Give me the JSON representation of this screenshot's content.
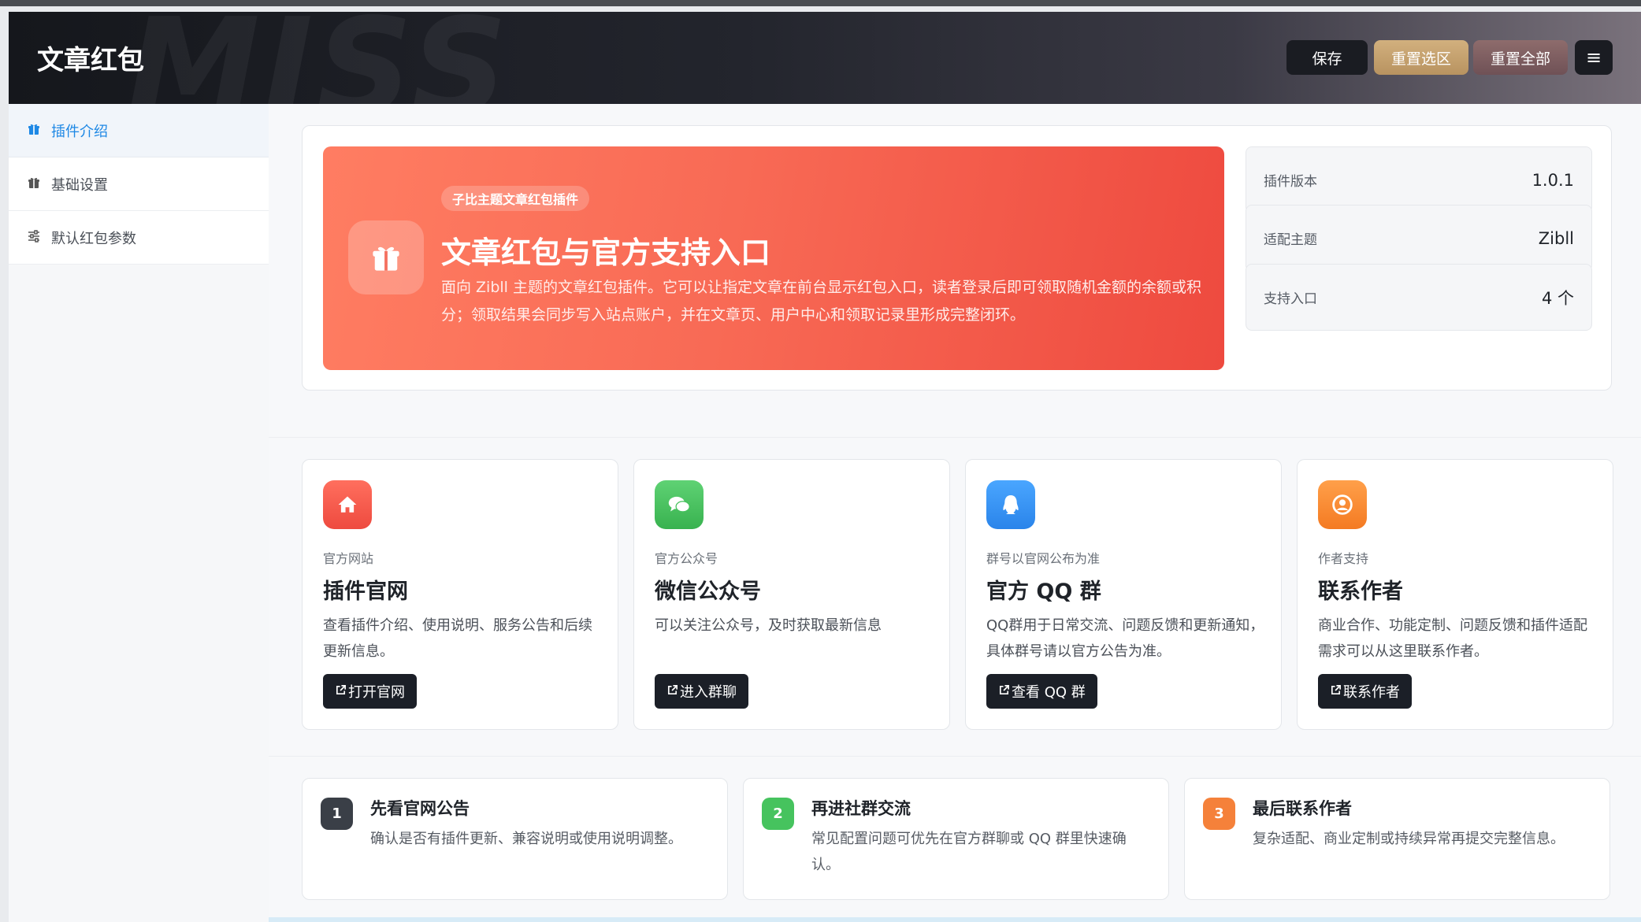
{
  "app": {
    "title": "文章红包",
    "watermark": "MISS"
  },
  "toolbar": {
    "save_label": "保存",
    "reset_selection_label": "重置选区",
    "reset_all_label": "重置全部",
    "menu_glyph": "≡"
  },
  "sidebar": {
    "items": [
      {
        "label": "插件介绍",
        "icon": "gift-icon",
        "active": true
      },
      {
        "label": "基础设置",
        "icon": "gift-icon",
        "active": false
      },
      {
        "label": "默认红包参数",
        "icon": "sliders-icon",
        "active": false
      }
    ]
  },
  "hero": {
    "badge": "子比主题文章红包插件",
    "title": "文章红包与官方支持入口",
    "description": "面向 Zibll 主题的文章红包插件。它可以让指定文章在前台显示红包入口，读者登录后即可领取随机金额的余额或积分；领取结果会同步写入站点账户，并在文章页、用户中心和领取记录里形成完整闭环。"
  },
  "stats": [
    {
      "label": "插件版本",
      "value": "1.0.1"
    },
    {
      "label": "适配主题",
      "value": "Zibll"
    },
    {
      "label": "支持入口",
      "value": "4 个"
    }
  ],
  "links": [
    {
      "icon": "home-icon",
      "color": "#f05a4a",
      "subtitle": "官方网站",
      "title": "插件官网",
      "description": "查看插件介绍、使用说明、服务公告和后续更新信息。",
      "button": "打开官网"
    },
    {
      "icon": "chat-icon",
      "color": "#42c25b",
      "subtitle": "官方公众号",
      "title": "微信公众号",
      "description": "可以关注公众号，及时获取最新信息",
      "button": "进入群聊"
    },
    {
      "icon": "qq-icon",
      "color": "#2f8ff2",
      "subtitle": "群号以官网公布为准",
      "title": "官方 QQ 群",
      "description": "QQ群用于日常交流、问题反馈和更新通知，具体群号请以官方公告为准。",
      "button": "查看 QQ 群"
    },
    {
      "icon": "user-icon",
      "color": "#f78a2b",
      "subtitle": "作者支持",
      "title": "联系作者",
      "description": "商业合作、功能定制、问题反馈和插件适配需求可以从这里联系作者。",
      "button": "联系作者"
    }
  ],
  "steps": [
    {
      "number": "1",
      "color": "#3a3f47",
      "title": "先看官网公告",
      "description": "确认是否有插件更新、兼容说明或使用说明调整。"
    },
    {
      "number": "2",
      "color": "#46c35e",
      "title": "再进社群交流",
      "description": "常见配置问题可优先在官方群聊或 QQ 群里快速确认。"
    },
    {
      "number": "3",
      "color": "#f5813a",
      "title": "最后联系作者",
      "description": "复杂适配、商业定制或持续异常再提交完整信息。"
    }
  ]
}
